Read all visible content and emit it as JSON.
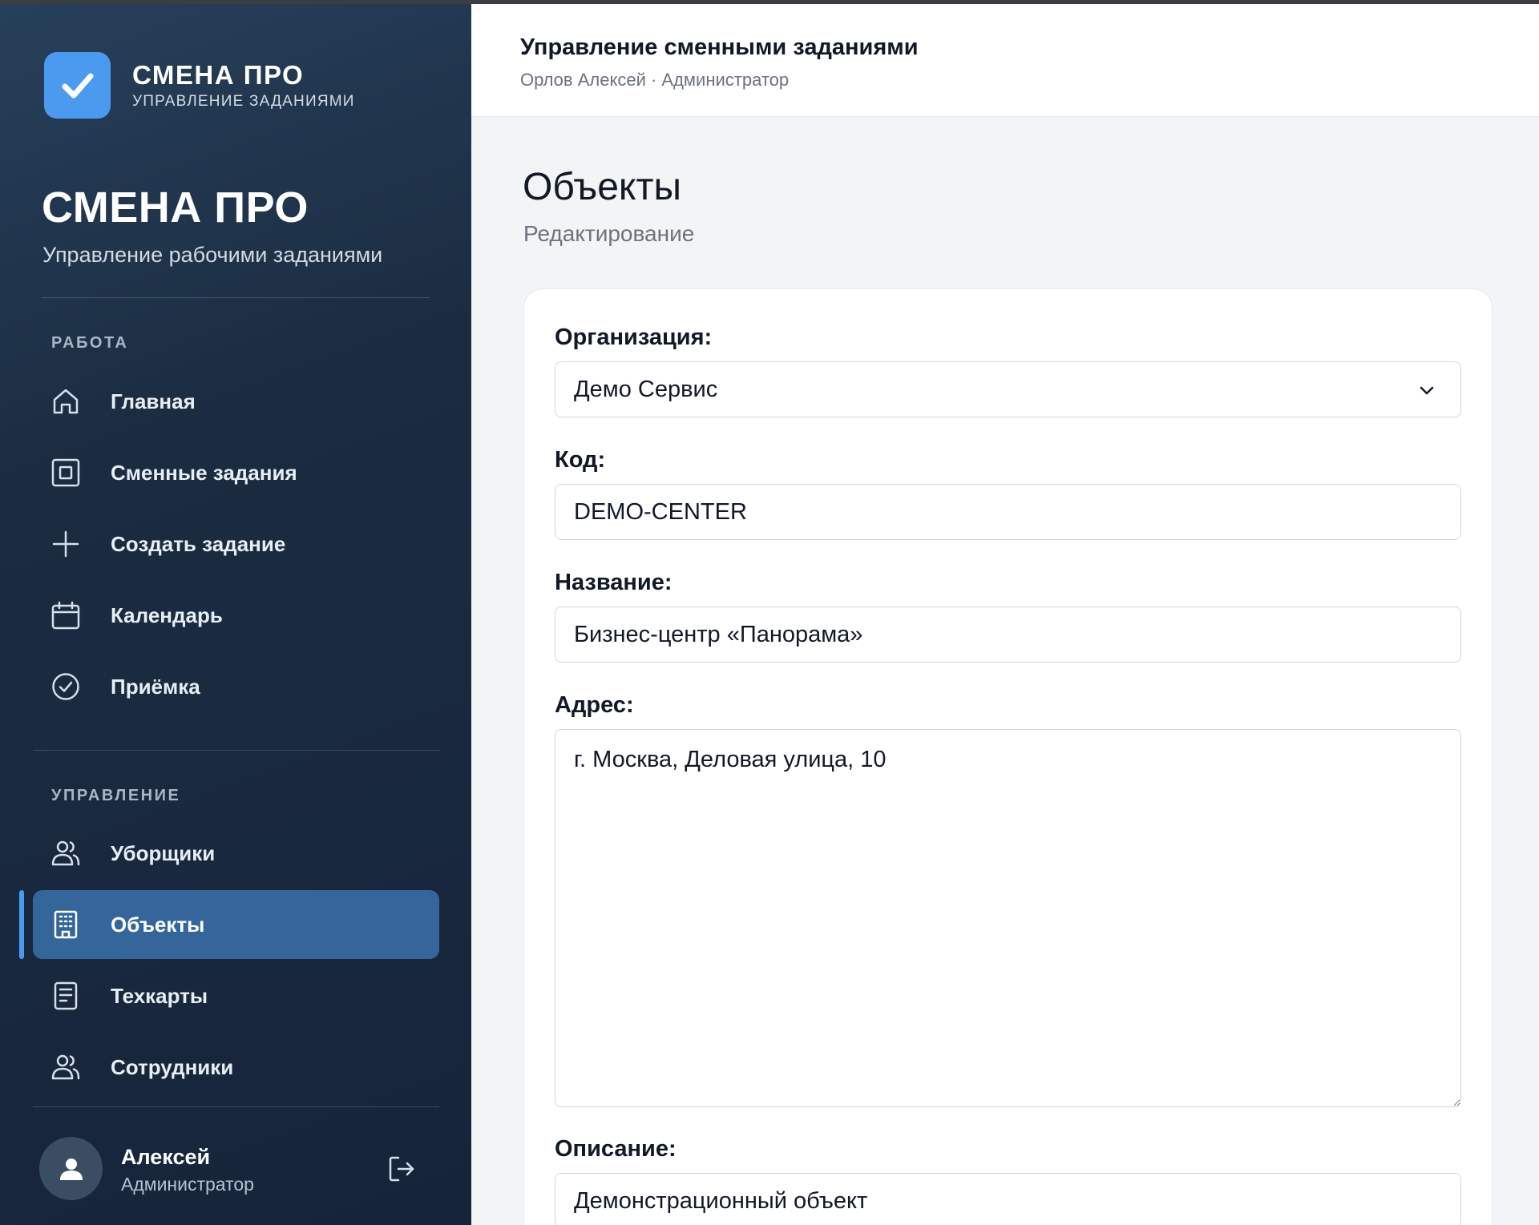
{
  "sidebar": {
    "brand_name": "СМЕНА ПРО",
    "brand_sub": "УПРАВЛЕНИЕ ЗАДАНИЯМИ",
    "app_title": "СМЕНА ПРО",
    "app_sub": "Управление рабочими заданиями",
    "sections": {
      "work": "РАБОТА",
      "manage": "УПРАВЛЕНИЕ"
    },
    "items": [
      {
        "label": "Главная",
        "icon": "home-icon"
      },
      {
        "label": "Сменные задания",
        "icon": "task-square-icon"
      },
      {
        "label": "Создать задание",
        "icon": "plus-icon"
      },
      {
        "label": "Календарь",
        "icon": "calendar-icon"
      },
      {
        "label": "Приёмка",
        "icon": "check-circle-icon"
      },
      {
        "label": "Уборщики",
        "icon": "users-icon"
      },
      {
        "label": "Объекты",
        "icon": "building-icon",
        "active": true
      },
      {
        "label": "Техкарты",
        "icon": "document-icon"
      },
      {
        "label": "Сотрудники",
        "icon": "users-icon"
      }
    ],
    "user": {
      "name": "Алексей",
      "role": "Администратор"
    }
  },
  "header": {
    "title": "Управление сменными заданиями",
    "subtitle": "Орлов Алексей · Администратор"
  },
  "page": {
    "title": "Объекты",
    "subtitle": "Редактирование"
  },
  "form": {
    "organization_label": "Организация:",
    "organization_value": "Демо Сервис",
    "code_label": "Код:",
    "code_value": "DEMO-CENTER",
    "name_label": "Название:",
    "name_value": "Бизнес-центр «Панорама»",
    "address_label": "Адрес:",
    "address_value": "г. Москва, Деловая улица, 10",
    "description_label": "Описание:",
    "description_value": "Демонстрационный объект"
  },
  "colors": {
    "accent": "#4a9bf0",
    "active_item": "#34669c",
    "sidebar_bg": "#16243a"
  }
}
